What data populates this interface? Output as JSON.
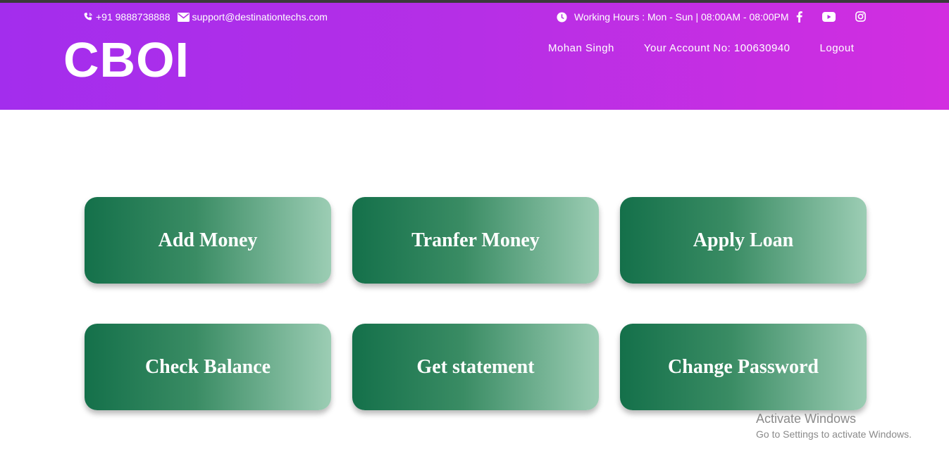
{
  "contact": {
    "phone": "+91 9888738888",
    "email": "support@destinationtechs.com"
  },
  "hours": "Working Hours : Mon - Sun | 08:00AM - 08:00PM",
  "social": [
    "facebook-icon",
    "youtube-icon",
    "instagram-icon"
  ],
  "brand": "CBOI",
  "nav": {
    "user": "Mohan Singh",
    "account": "Your Account No: 100630940",
    "logout": "Logout"
  },
  "actions": [
    {
      "label": "Add Money"
    },
    {
      "label": "Tranfer Money"
    },
    {
      "label": "Apply Loan"
    },
    {
      "label": "Check Balance"
    },
    {
      "label": "Get statement"
    },
    {
      "label": "Change Password"
    }
  ],
  "watermark": {
    "title": "Activate Windows",
    "subtitle": "Go to Settings to activate Windows."
  },
  "colors": {
    "header_start": "#a32ded",
    "header_end": "#d22ee0",
    "card_start": "#14704a",
    "card_end": "#9ccdb4"
  }
}
